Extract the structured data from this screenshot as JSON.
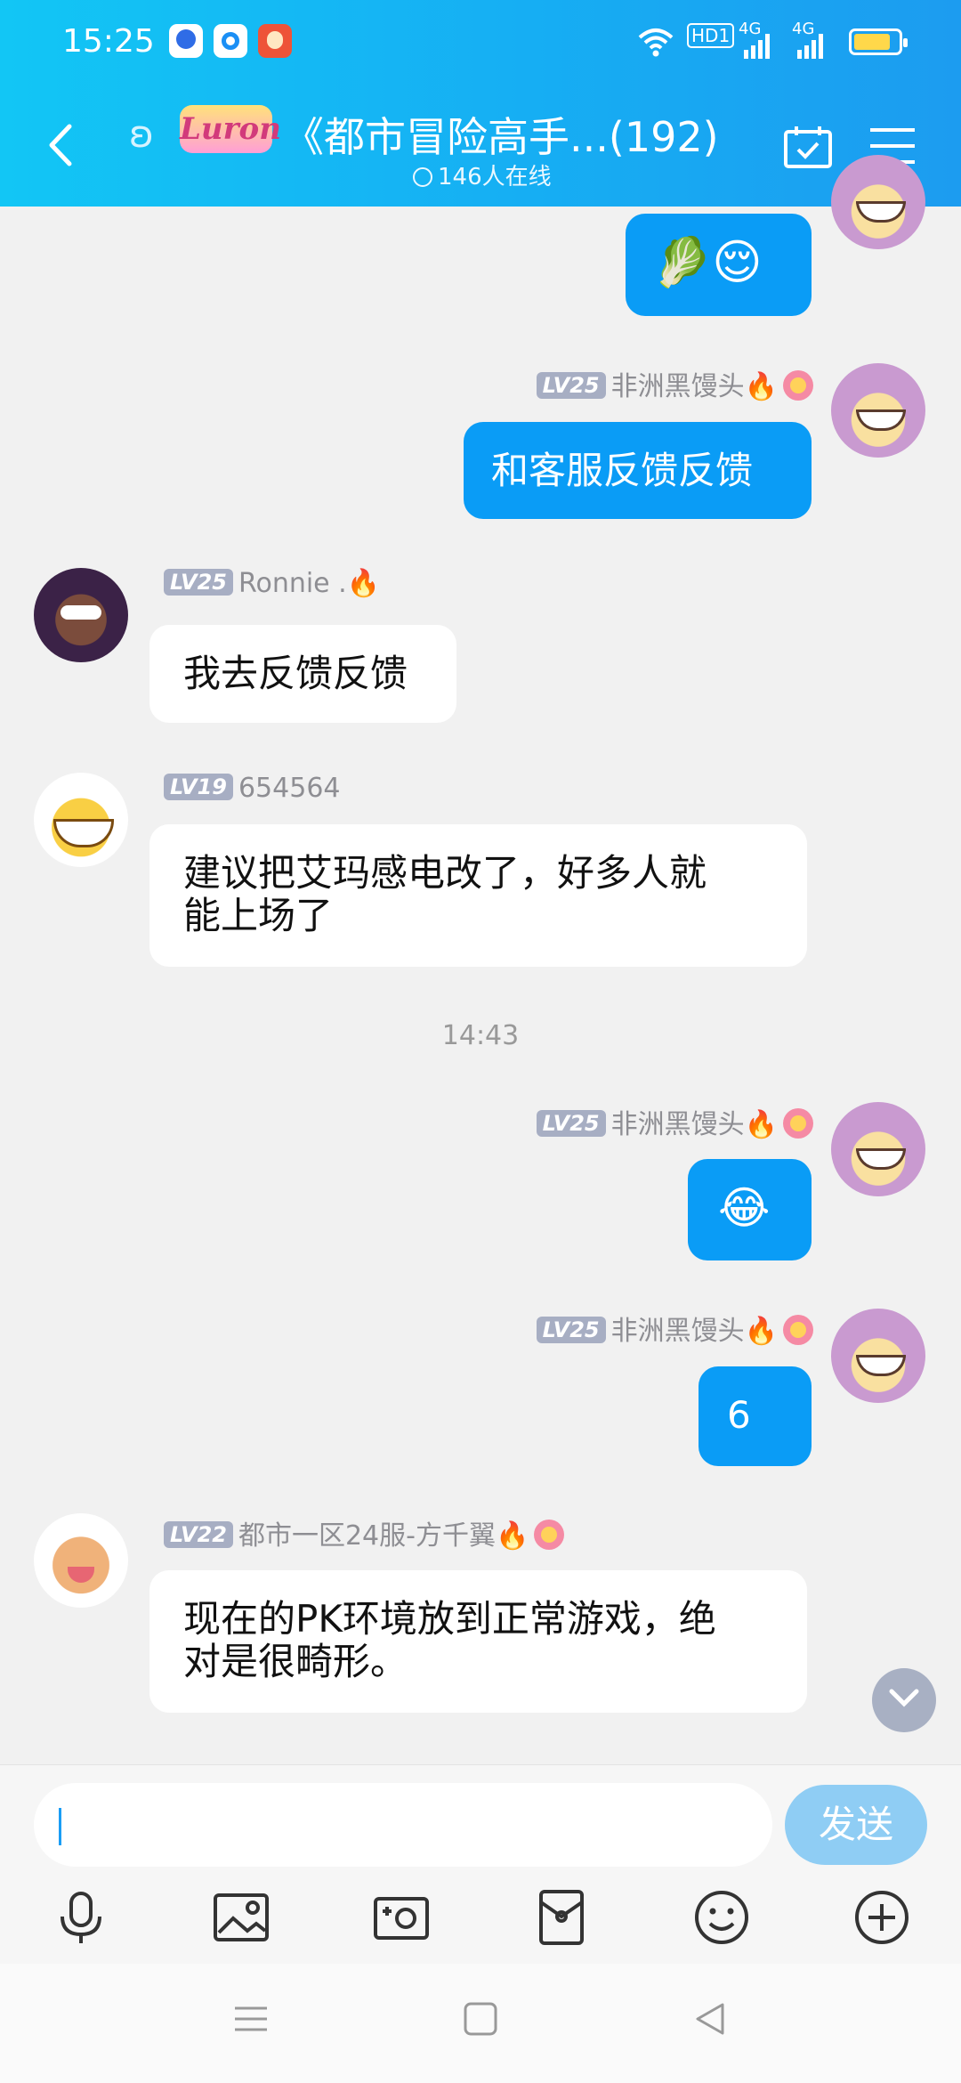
{
  "status_bar": {
    "time": "15:25",
    "hd": "HD1",
    "net1": "4G",
    "net2": "4G",
    "battery_color": "#ffd84a"
  },
  "header": {
    "logo_text": "Luron",
    "title": "《都市冒险高手...(192)",
    "online": "146人在线",
    "bg_color": "#16aef3"
  },
  "messages": [
    {
      "side": "me",
      "type": "emoji",
      "content": "🥬😌"
    },
    {
      "side": "me",
      "level": "LV25",
      "name": "非洲黑馒头",
      "text": "和客服反馈反馈"
    },
    {
      "side": "them",
      "level": "LV25",
      "name": "Ronnie .",
      "text": "我去反馈反馈"
    },
    {
      "side": "them",
      "level": "LV19",
      "name": "654564",
      "text_line1": "建议把艾玛感电改了，好多人就",
      "text_line2": "能上场了"
    },
    {
      "side": "me",
      "level": "LV25",
      "name": "非洲黑馒头",
      "text": "😂"
    },
    {
      "side": "me",
      "level": "LV25",
      "name": "非洲黑馒头",
      "text": "6"
    },
    {
      "side": "them",
      "level": "LV22",
      "name": "都市一区24服-方千翼",
      "text_line1": "现在的PK环境放到正常游戏，绝",
      "text_line2": "对是很畸形。"
    }
  ],
  "timestamp": "14:43",
  "input": {
    "value": "",
    "send_label": "发送"
  },
  "toolbar": [
    "microphone-icon",
    "image-icon",
    "camera-icon",
    "red-packet-icon",
    "emoji-icon",
    "plus-icon"
  ],
  "accent_color": "#0a9cf6"
}
